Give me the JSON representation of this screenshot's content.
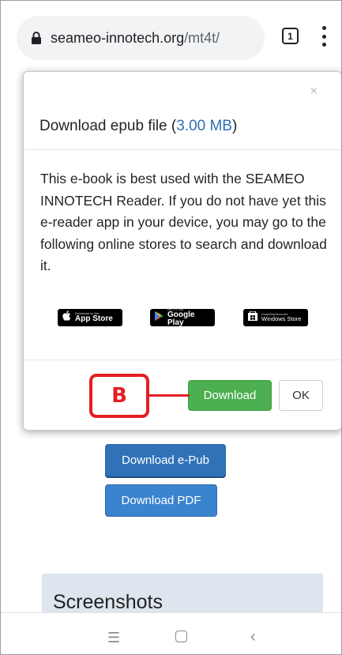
{
  "browser": {
    "url_domain": "seameo-innotech.org",
    "url_path": "/mt4t/",
    "tab_count": "1"
  },
  "page": {
    "download_epub_label": "Download e-Pub",
    "download_pdf_label": "Download PDF",
    "screenshots_heading": "Screenshots"
  },
  "modal": {
    "close_label": "×",
    "title_prefix": "Download epub file (",
    "file_size": "3.00 MB",
    "title_suffix": ")",
    "body_text": "This e-book is best used with the SEAMEO INNOTECH Reader. If you do not have yet this e-reader app in your device, you may go to the following online stores to search and download it.",
    "stores": {
      "appstore_small": "Download on the",
      "appstore_big": "App Store",
      "gplay_small": "GET IT ON",
      "gplay_big": "Google Play",
      "windows_small": "Download from the",
      "windows_big": "Windows Store"
    },
    "download_label": "Download",
    "ok_label": "OK"
  },
  "annotation": {
    "callout_label": "B",
    "color": "#e31e24"
  },
  "nav": {
    "recent_glyph": "☰",
    "back_glyph": "‹"
  },
  "colors": {
    "download_green": "#4caf50",
    "primary_blue": "#3a7fcb",
    "link_blue": "#2f6fb5"
  }
}
